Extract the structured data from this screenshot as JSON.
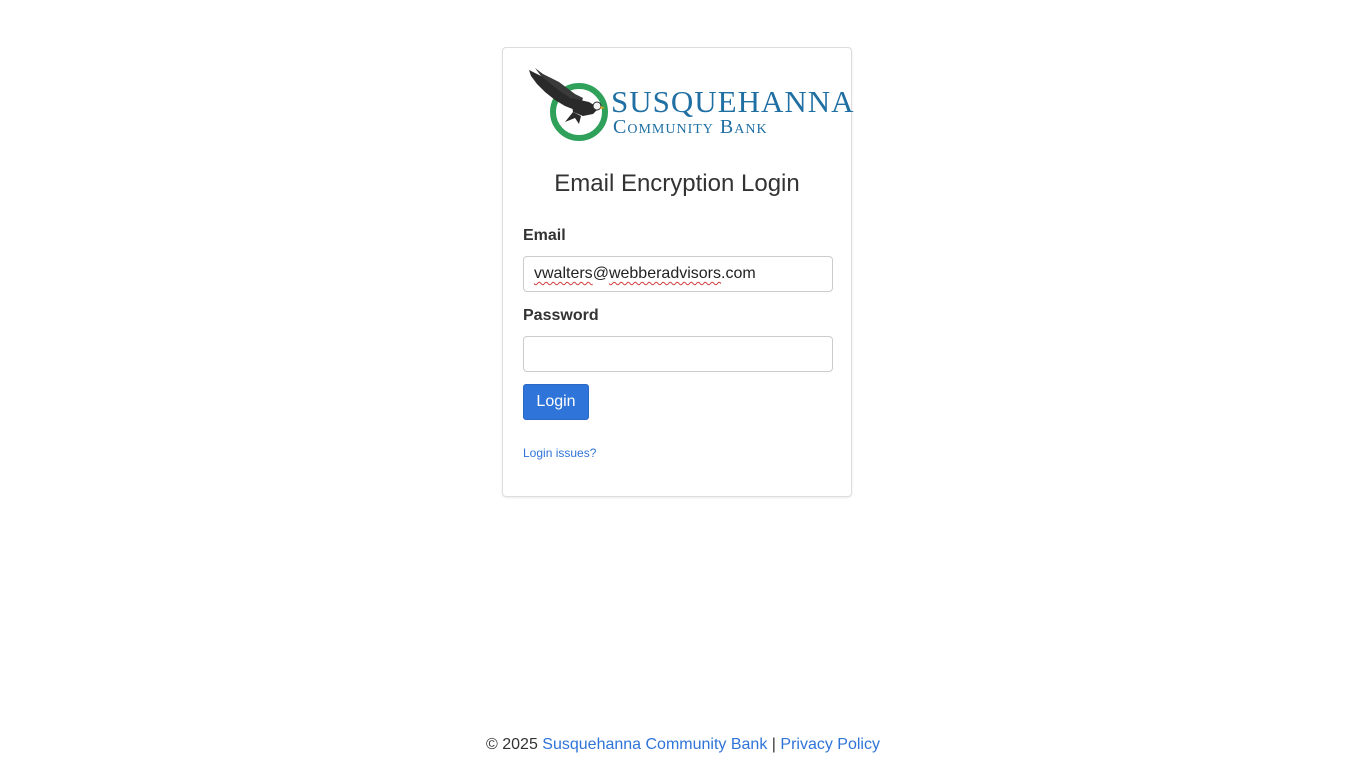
{
  "logo": {
    "line1": "Susquehanna",
    "line2": "Community Bank",
    "colors": {
      "eagle": "#2a2a2a",
      "ring": "#2fa15a",
      "text": "#1f6fa3"
    }
  },
  "form": {
    "title": "Email Encryption Login",
    "email_label": "Email",
    "email_value_user": "vwalters",
    "email_value_domain": "webberadvisors",
    "email_value_at": "@",
    "email_value_tld": ".com",
    "password_label": "Password",
    "password_value": "",
    "login_button": "Login",
    "issues_link": "Login issues?"
  },
  "footer": {
    "copyright": "© 2025",
    "bank_link": "Susquehanna Community Bank",
    "separator": "|",
    "privacy_link": "Privacy Policy"
  },
  "colors": {
    "accent": "#2f74d8",
    "border": "#dddddd",
    "text": "#333333"
  }
}
